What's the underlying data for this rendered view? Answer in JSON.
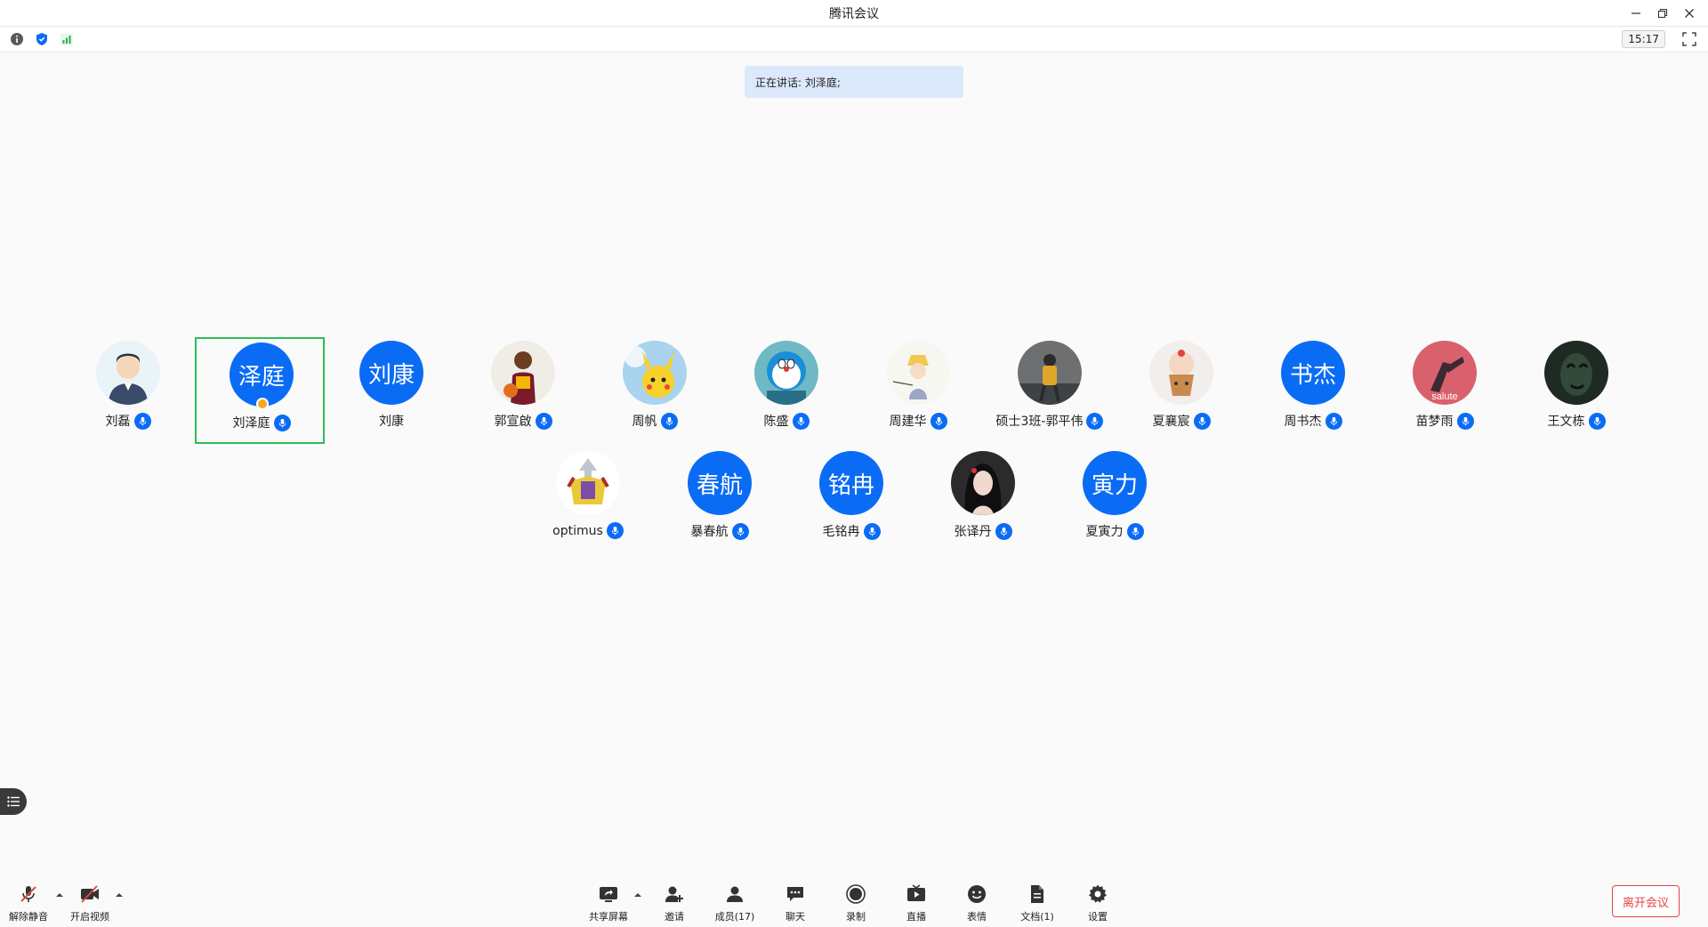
{
  "window": {
    "title": "腾讯会议",
    "controls": [
      {
        "name": "minimize",
        "icon": "minimize-icon"
      },
      {
        "name": "restore",
        "icon": "restore-icon"
      },
      {
        "name": "close",
        "icon": "close-icon"
      }
    ]
  },
  "infobar": {
    "time": "15:17",
    "icons": [
      "info-icon",
      "security-shield-icon",
      "signal-bars-icon"
    ]
  },
  "speaking": {
    "text": "正在讲话: 刘泽庭;"
  },
  "participants": [
    {
      "name": "刘磊",
      "avatar_type": "image",
      "avatar_icon": "cartoon-man-avatar",
      "mic": true
    },
    {
      "name": "刘泽庭",
      "avatar_type": "text",
      "avatar_text": "泽庭",
      "mic": true,
      "active": true,
      "host": true
    },
    {
      "name": "刘康",
      "avatar_type": "text",
      "avatar_text": "刘康",
      "mic": false
    },
    {
      "name": "郭宣啟",
      "avatar_type": "image",
      "avatar_icon": "basketball-player-avatar",
      "mic": true
    },
    {
      "name": "周帆",
      "avatar_type": "image",
      "avatar_icon": "pikachu-avatar",
      "mic": true
    },
    {
      "name": "陈盛",
      "avatar_type": "image",
      "avatar_icon": "doraemon-avatar",
      "mic": true
    },
    {
      "name": "周建华",
      "avatar_type": "image",
      "avatar_icon": "fishing-child-avatar",
      "mic": true
    },
    {
      "name": "硕士3班-郭平伟",
      "avatar_type": "image",
      "avatar_icon": "hiker-avatar",
      "mic": true
    },
    {
      "name": "夏襄宸",
      "avatar_type": "image",
      "avatar_icon": "cupcake-avatar",
      "mic": true
    },
    {
      "name": "周书杰",
      "avatar_type": "text",
      "avatar_text": "书杰",
      "mic": true
    },
    {
      "name": "苗梦雨",
      "avatar_type": "image",
      "avatar_icon": "salute-meme-avatar",
      "mic": true
    },
    {
      "name": "王文栋",
      "avatar_type": "image",
      "avatar_icon": "dark-face-avatar",
      "mic": true
    },
    {
      "name": "optimus",
      "avatar_type": "image",
      "avatar_icon": "robot-avatar",
      "mic": true
    },
    {
      "name": "暴春航",
      "avatar_type": "text",
      "avatar_text": "春航",
      "mic": true
    },
    {
      "name": "毛铭冉",
      "avatar_type": "text",
      "avatar_text": "铭冉",
      "mic": true
    },
    {
      "name": "张译丹",
      "avatar_type": "image",
      "avatar_icon": "woman-photo-avatar",
      "mic": true
    },
    {
      "name": "夏寅力",
      "avatar_type": "text",
      "avatar_text": "寅力",
      "mic": true
    }
  ],
  "toolbar": {
    "left": [
      {
        "label": "解除静音",
        "icon": "mic-muted-icon",
        "has_caret": true
      },
      {
        "label": "开启视频",
        "icon": "video-off-icon",
        "has_caret": true
      }
    ],
    "center": [
      {
        "label": "共享屏幕",
        "icon": "share-screen-icon",
        "has_caret": true
      },
      {
        "label": "邀请",
        "icon": "invite-icon"
      },
      {
        "label": "成员(17)",
        "icon": "members-icon"
      },
      {
        "label": "聊天",
        "icon": "chat-icon"
      },
      {
        "label": "录制",
        "icon": "record-icon"
      },
      {
        "label": "直播",
        "icon": "live-icon"
      },
      {
        "label": "表情",
        "icon": "emoji-icon"
      },
      {
        "label": "文档(1)",
        "icon": "document-icon"
      },
      {
        "label": "设置",
        "icon": "settings-icon"
      }
    ],
    "leave_label": "离开会议"
  },
  "colors": {
    "accent": "#0a6cf5",
    "active_border": "#2ebd58",
    "leave": "#e54545",
    "banner": "#dbe9fb"
  }
}
